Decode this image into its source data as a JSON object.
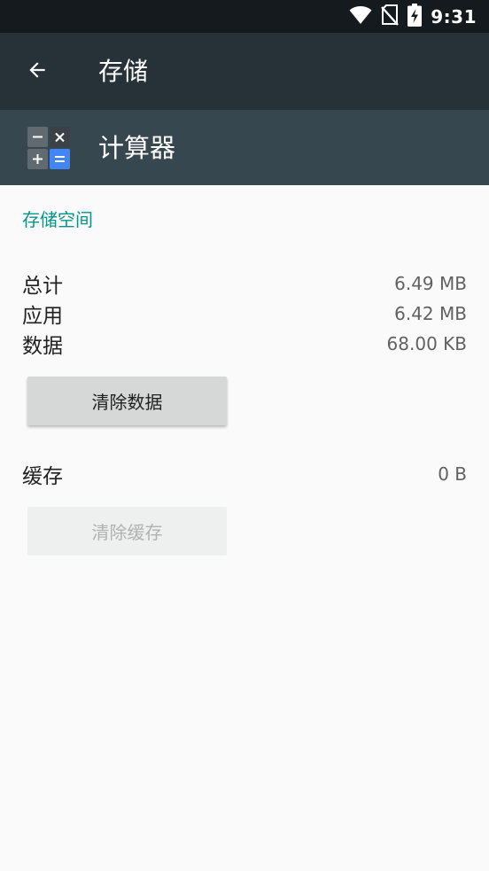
{
  "status_bar": {
    "time": "9:31",
    "icons": [
      "wifi-icon",
      "no-sim-icon",
      "battery-charging-icon"
    ]
  },
  "toolbar": {
    "back_icon": "arrow-back-icon",
    "title": "存储"
  },
  "app_header": {
    "icon": "calculator-app-icon",
    "name": "计算器"
  },
  "storage": {
    "section_title": "存储空间",
    "total_label": "总计",
    "total_value": "6.49 MB",
    "app_label": "应用",
    "app_value": "6.42 MB",
    "data_label": "数据",
    "data_value": "68.00 KB",
    "clear_data_label": "清除数据",
    "cache_label": "缓存",
    "cache_value": "0 B",
    "clear_cache_label": "清除缓存"
  },
  "colors": {
    "status_bar": "#141a1d",
    "toolbar": "#263238",
    "app_header": "#37474f",
    "accent": "#009688",
    "background": "#fafafa"
  }
}
